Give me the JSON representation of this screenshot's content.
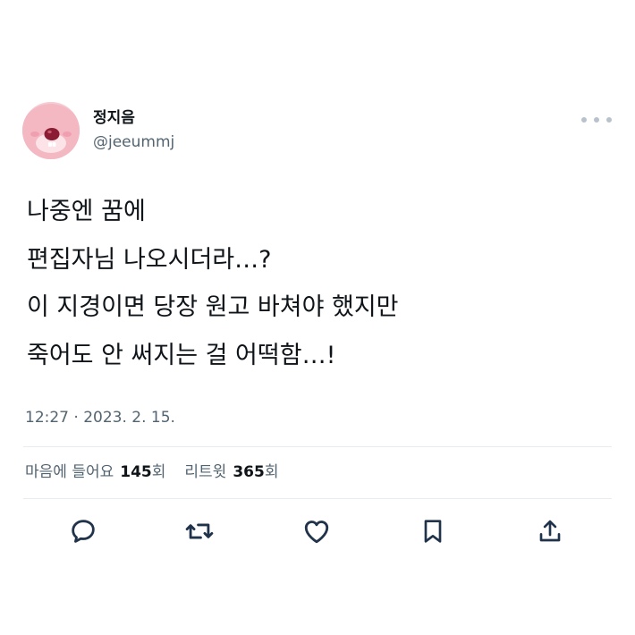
{
  "author": {
    "display_name": "정지음",
    "handle": "@jeeummj"
  },
  "tweet": {
    "lines": [
      "나중엔 꿈에",
      "편집자님 나오시더라…?",
      "이 지경이면 당장 원고 바쳐야 했지만",
      "죽어도 안 써지는 걸 어떡함…!"
    ],
    "timestamp": "12:27 · 2023. 2. 15."
  },
  "stats": {
    "likes_label": "마음에 들어요",
    "likes_count": "145",
    "likes_suffix": "회",
    "retweets_label": "리트윗",
    "retweets_count": "365",
    "retweets_suffix": "회"
  },
  "icons": {
    "reply": "reply-icon",
    "retweet": "retweet-icon",
    "like": "heart-icon",
    "bookmark": "bookmark-icon",
    "share": "share-icon",
    "more": "more-icon"
  },
  "colors": {
    "text": "#0f1419",
    "secondary": "#536471",
    "divider": "#e6ecf0",
    "icon": "#20334a"
  }
}
